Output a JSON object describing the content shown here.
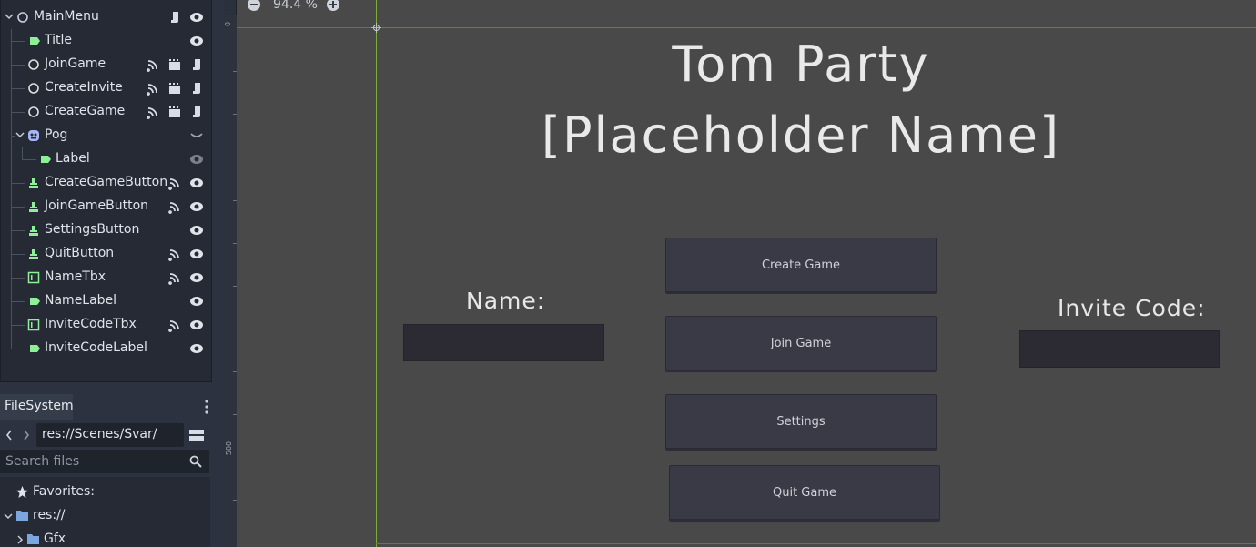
{
  "scene_tree": {
    "nodes": [
      {
        "label": "MainMenu",
        "icon": "control-node-icon"
      },
      {
        "label": "Title",
        "icon": "label-node-icon"
      },
      {
        "label": "JoinGame",
        "icon": "node-circle-icon"
      },
      {
        "label": "CreateInvite",
        "icon": "node-circle-icon"
      },
      {
        "label": "CreateGame",
        "icon": "node-circle-icon"
      },
      {
        "label": "Pog",
        "icon": "sprite-node-icon"
      },
      {
        "label": "Label",
        "icon": "label-node-icon"
      },
      {
        "label": "CreateGameButton",
        "icon": "button-node-icon"
      },
      {
        "label": "JoinGameButton",
        "icon": "button-node-icon"
      },
      {
        "label": "SettingsButton",
        "icon": "button-node-icon"
      },
      {
        "label": "QuitButton",
        "icon": "button-node-icon"
      },
      {
        "label": "NameTbx",
        "icon": "lineedit-node-icon"
      },
      {
        "label": "NameLabel",
        "icon": "label-node-icon"
      },
      {
        "label": "InviteCodeTbx",
        "icon": "lineedit-node-icon"
      },
      {
        "label": "InviteCodeLabel",
        "icon": "label-node-icon"
      }
    ]
  },
  "filesystem": {
    "tab_label": "FileSystem",
    "path": "res://Scenes/Svar/",
    "search_placeholder": "Search files",
    "favorites_label": "Favorites:",
    "root_label": "res://",
    "gfx_label": "Gfx"
  },
  "viewport": {
    "zoom_text": "94.4 %",
    "ruler_label_0": "0",
    "ruler_label_500": "500"
  },
  "game": {
    "title_line1": "Tom Party",
    "title_line2": "[Placeholder Name]",
    "create_game_label": "Create Game",
    "join_game_label": "Join Game",
    "settings_label": "Settings",
    "quit_game_label": "Quit Game",
    "name_label": "Name:",
    "invite_code_label": "Invite Code:"
  },
  "colors": {
    "accent_green": "#8eef97",
    "node_white": "#e0e0e0",
    "sprite_purple": "#a5b7f3"
  }
}
